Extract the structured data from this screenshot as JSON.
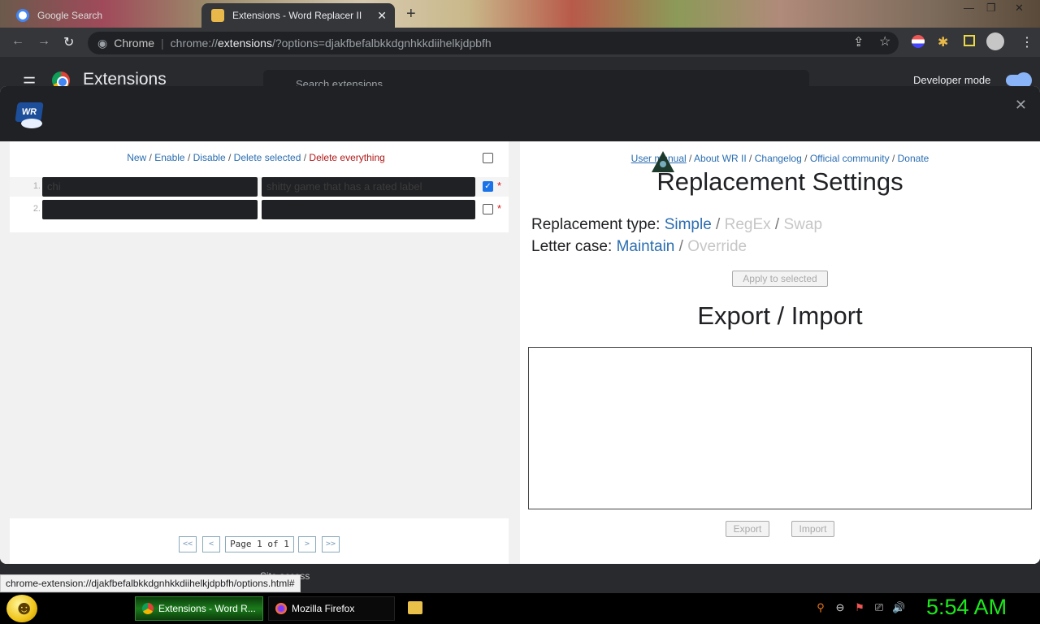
{
  "browser": {
    "tabs": [
      {
        "title": "Google Search",
        "active": false
      },
      {
        "title": "Extensions - Word Replacer II",
        "active": true
      }
    ],
    "tab_close": "✕",
    "new_tab": "+",
    "window_controls": [
      "—",
      "❐",
      "✕"
    ],
    "site_label": "Chrome",
    "url_prefix": "chrome://",
    "url_host": "extensions",
    "url_rest": "/?options=djakfbefalbkkdgnhkkdiihelkjdpbfh"
  },
  "ext_page": {
    "title": "Extensions",
    "search_placeholder": "Search extensions",
    "developer_mode_label": "Developer mode",
    "developer_mode_on": true,
    "caption_fragment": "Site access"
  },
  "dialog": {
    "logo_text": "WR",
    "close": "✕",
    "left": {
      "actions": {
        "new": "New",
        "enable": "Enable",
        "disable": "Disable",
        "delete_selected": "Delete selected",
        "delete_everything": "Delete everything",
        "sep": " / "
      },
      "rows": [
        {
          "num": "1.",
          "find": "chi",
          "replace": "shitty game that has a rated label",
          "checked": true,
          "star": "*"
        },
        {
          "num": "2.",
          "find": "",
          "replace": "",
          "checked": false,
          "star": "*"
        }
      ],
      "pager": {
        "first": "<<",
        "prev": "<",
        "label": "Page 1 of 1",
        "next": ">",
        "last": ">>"
      }
    },
    "right": {
      "links": {
        "manual": "User manual",
        "about": "About WR II",
        "changelog": "Changelog",
        "community": "Official community",
        "donate": "Donate",
        "sep": " / "
      },
      "settings_title": "Replacement Settings",
      "type_label": "Replacement type:",
      "type_options": [
        "Simple",
        "RegEx",
        "Swap"
      ],
      "case_label": "Letter case:",
      "case_options": [
        "Maintain",
        "Override"
      ],
      "slash": " / ",
      "apply_button": "Apply to selected",
      "export_title": "Export / Import",
      "export_button": "Export",
      "import_button": "Import"
    }
  },
  "status_url": "chrome-extension://djakfbefalbkkdgnhkkdiihelkjdpbfh/options.html#",
  "taskbar": {
    "task1": "Extensions - Word R...",
    "task2": "Mozilla Firefox",
    "clock": "5:54 AM"
  },
  "colors": {
    "link": "#2a6db0",
    "danger": "#b01818",
    "disabled": "#c6c6c6",
    "clock": "#1ce81c"
  }
}
